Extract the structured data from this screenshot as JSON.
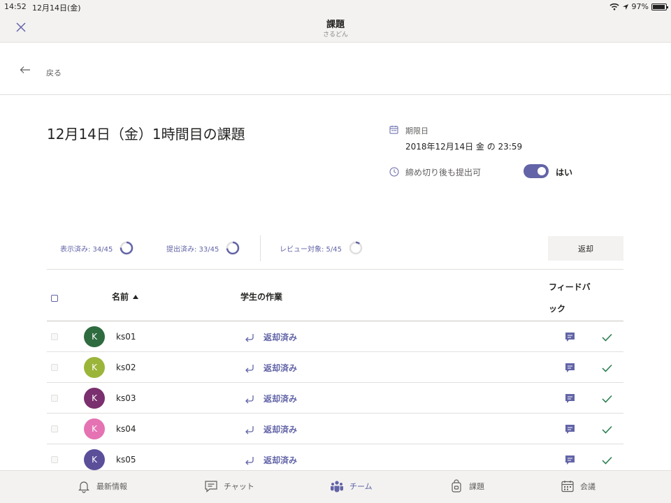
{
  "status_bar": {
    "time": "14:52",
    "date": "12月14日(金)",
    "battery": "97%",
    "battery_level": 0.97
  },
  "header": {
    "title": "課題",
    "subtitle": "さるどん"
  },
  "back": {
    "label": "戻る"
  },
  "assignment": {
    "title": "12月14日（金）1時間目の課題",
    "due_label": "期限日",
    "due_value": "2018年12月14日 金 の 23:59",
    "late_label": "締め切り後も提出可",
    "late_value": "はい",
    "late_enabled": true
  },
  "stats": [
    {
      "label": "表示済み: 34/45",
      "done": 34,
      "total": 45
    },
    {
      "label": "提出済み: 33/45",
      "done": 33,
      "total": 45
    },
    {
      "label": "レビュー対象: 5/45",
      "done": 5,
      "total": 45
    }
  ],
  "return_button": "返却",
  "table": {
    "headers": {
      "name": "名前",
      "work": "学生の作業",
      "feedback": "フィードバック"
    },
    "rows": [
      {
        "initial": "K",
        "name": "ks01",
        "status": "返却済み",
        "color": "#2e6b3f"
      },
      {
        "initial": "K",
        "name": "ks02",
        "status": "返却済み",
        "color": "#9bb53a"
      },
      {
        "initial": "K",
        "name": "ks03",
        "status": "返却済み",
        "color": "#7a2f6e"
      },
      {
        "initial": "K",
        "name": "ks04",
        "status": "返却済み",
        "color": "#e572b3"
      },
      {
        "initial": "K",
        "name": "ks05",
        "status": "返却済み",
        "color": "#5b4f9a"
      }
    ]
  },
  "tabs": [
    {
      "label": "最新情報",
      "icon": "bell-icon"
    },
    {
      "label": "チャット",
      "icon": "chat-icon"
    },
    {
      "label": "チーム",
      "icon": "teams-icon",
      "active": true
    },
    {
      "label": "課題",
      "icon": "assignment-bag-icon"
    },
    {
      "label": "会議",
      "icon": "calendar-icon"
    }
  ],
  "colors": {
    "accent": "#6264a7",
    "check": "#237b4b",
    "header_bg": "#f3f2f1"
  }
}
